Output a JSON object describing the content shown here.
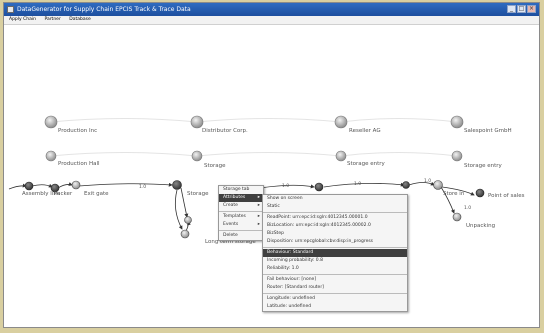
{
  "window": {
    "title": "DataGenerator for Supply Chain EPCIS Track & Trace Data",
    "controls": [
      "_",
      "□",
      "×"
    ]
  },
  "menu": [
    "Apply Chain",
    "Partner",
    "Database"
  ],
  "partners": [
    {
      "label": "Production Inc"
    },
    {
      "label": "Distributor Corp."
    },
    {
      "label": "Reseller AG"
    },
    {
      "label": "Salespoint GmbH"
    }
  ],
  "locations": [
    {
      "label": "Production Hall"
    },
    {
      "label": "Storage"
    },
    {
      "label": "Storage entry"
    },
    {
      "label": "Storage entry"
    }
  ],
  "steps": [
    {
      "label": "Assembly line"
    },
    {
      "label": "Packer"
    },
    {
      "label": "Exit gate"
    },
    {
      "label": "Storage"
    },
    {
      "label": "Long term storage"
    },
    {
      "label": "Store in"
    },
    {
      "label": "Point of sales"
    },
    {
      "label": "Unpacking"
    }
  ],
  "edge_labels": [
    "1.0",
    "1.0",
    "1.0",
    "1.0",
    "1.0"
  ],
  "context_menu": {
    "items": [
      {
        "label": "Storage tab",
        "submenu": false
      },
      {
        "label": "Attributes",
        "submenu": true,
        "selected": true
      },
      {
        "label": "Create",
        "submenu": true
      },
      {
        "label": "Templates",
        "submenu": true
      },
      {
        "label": "Events",
        "submenu": true
      },
      {
        "label": "Delete",
        "submenu": false
      }
    ]
  },
  "submenu": {
    "group1": [
      "Show on screen",
      "Static"
    ],
    "group2": [
      "ReadPoint: urn:epc:id:sgln:4012345.00001.0",
      "BizLocation: urn:epc:id:sgln:4012345.00002.0",
      "BizStep",
      "Disposition: urn:epcglobal:cbv:disp:in_progress"
    ],
    "highlighted": "Behaviour: Standard",
    "group3": [
      "Incoming probability: 0.8",
      "Reliability: 1.0"
    ],
    "group4": [
      "Fail behaviour: [none]",
      "Router: [Standard router]"
    ],
    "group5": [
      "Longitude: undefined",
      "Latitude: undefined"
    ]
  }
}
